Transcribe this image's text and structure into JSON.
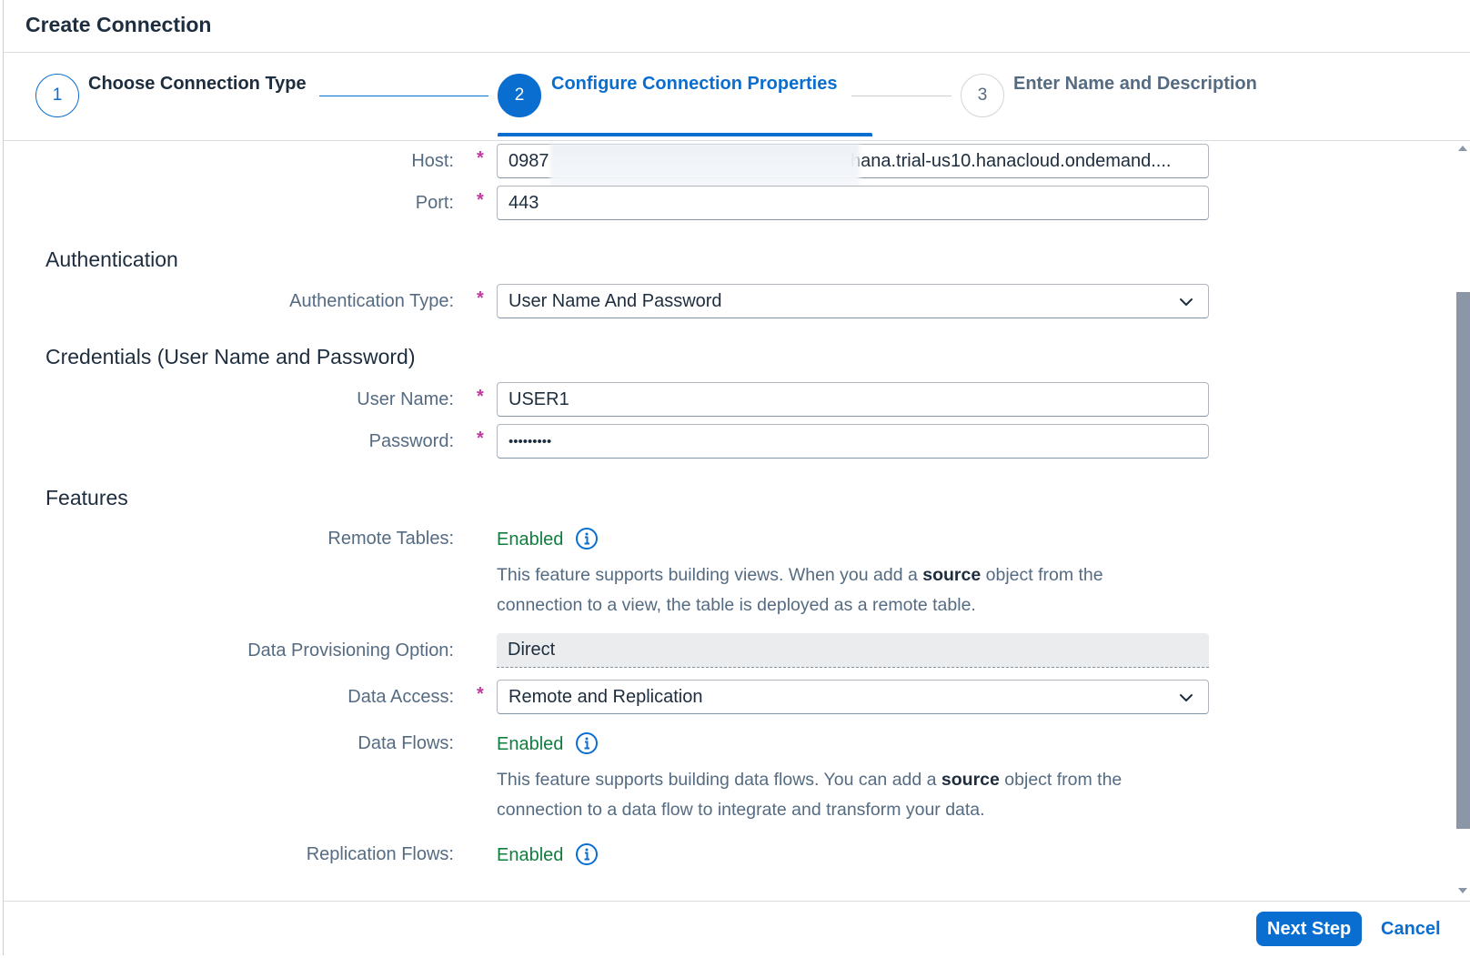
{
  "dialog": {
    "title": "Create Connection"
  },
  "wizard": {
    "steps": [
      {
        "number": "1",
        "label": "Choose Connection Type",
        "state": "done"
      },
      {
        "number": "2",
        "label": "Configure Connection Properties",
        "state": "active"
      },
      {
        "number": "3",
        "label": "Enter Name and Description",
        "state": "todo"
      }
    ]
  },
  "form": {
    "host": {
      "label": "Host:",
      "value_prefix": "0987",
      "value_suffix": "hana.trial-us10.hanacloud.ondemand...."
    },
    "port": {
      "label": "Port:",
      "value": "443"
    },
    "authentication": {
      "title": "Authentication",
      "type_label": "Authentication Type:",
      "type_value": "User Name And Password"
    },
    "credentials": {
      "title": "Credentials (User Name and Password)",
      "user_label": "User Name:",
      "user_value": "USER1",
      "password_label": "Password:",
      "password_value": "•••••••••"
    },
    "features": {
      "title": "Features",
      "remote_tables_label": "Remote Tables:",
      "remote_tables_status": "Enabled",
      "remote_tables_desc_1": "This feature supports building views. When you add a ",
      "remote_tables_desc_bold": "source",
      "remote_tables_desc_2": " object from the connection to a view, the table is deployed as a remote table.",
      "provisioning_label": "Data Provisioning Option:",
      "provisioning_value": "Direct",
      "data_access_label": "Data Access:",
      "data_access_value": "Remote and Replication",
      "data_flows_label": "Data Flows:",
      "data_flows_status": "Enabled",
      "data_flows_desc_1": "This feature supports building data flows. You can add a ",
      "data_flows_desc_bold": "source",
      "data_flows_desc_2": " object from the connection to a data flow to integrate and transform your data.",
      "replication_flows_label": "Replication Flows:",
      "replication_flows_status": "Enabled"
    },
    "required_marker": "*"
  },
  "footer": {
    "next_label": "Next Step",
    "cancel_label": "Cancel"
  },
  "colors": {
    "accent": "#0a6ed1",
    "enabled": "#107e3e",
    "required": "#c0399f"
  }
}
